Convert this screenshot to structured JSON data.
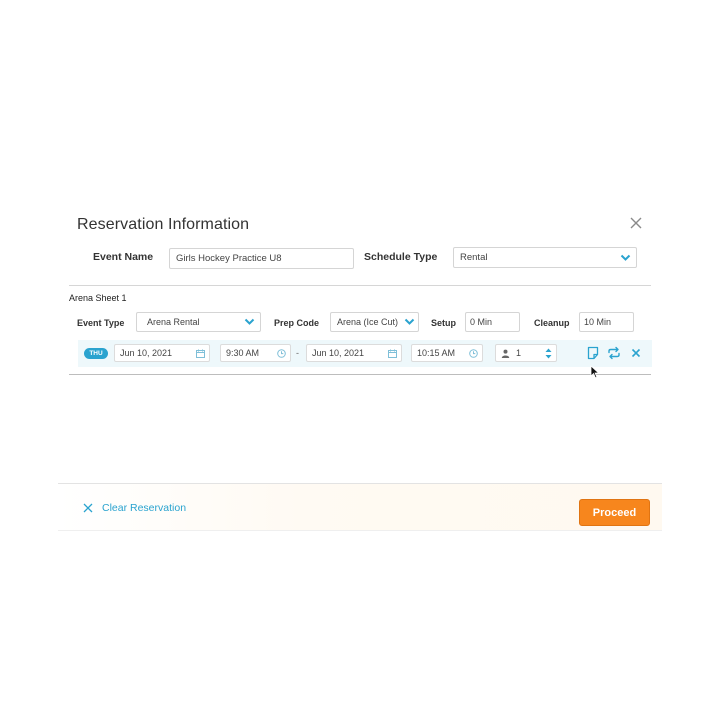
{
  "modal": {
    "title": "Reservation Information",
    "event_name": {
      "label": "Event Name",
      "value": "Girls Hockey Practice U8"
    },
    "schedule_type": {
      "label": "Schedule Type",
      "value": "Rental"
    }
  },
  "resource": {
    "name": "Arena Sheet 1",
    "event_type": {
      "label": "Event Type",
      "value": "Arena Rental"
    },
    "prep_code": {
      "label": "Prep Code",
      "value": "Arena (Ice Cut)"
    },
    "setup": {
      "label": "Setup",
      "value": "0 Min"
    },
    "cleanup": {
      "label": "Cleanup",
      "value": "10 Min"
    },
    "booking": {
      "day": "THU",
      "start_date": "Jun 10, 2021",
      "start_time": "9:30 AM",
      "separator": "-",
      "end_date": "Jun 10, 2021",
      "end_time": "10:15 AM",
      "attendees": "1"
    }
  },
  "footer": {
    "clear_label": "Clear Reservation",
    "proceed_label": "Proceed"
  },
  "colors": {
    "accent": "#2aa3cf",
    "primary_button": "#f7861d",
    "row_highlight": "#eef8fb"
  },
  "icons": [
    "close-icon",
    "chevron-down-icon",
    "calendar-icon",
    "clock-icon",
    "person-icon",
    "stepper-icon",
    "note-icon",
    "repeat-icon",
    "remove-icon",
    "cursor-icon"
  ]
}
